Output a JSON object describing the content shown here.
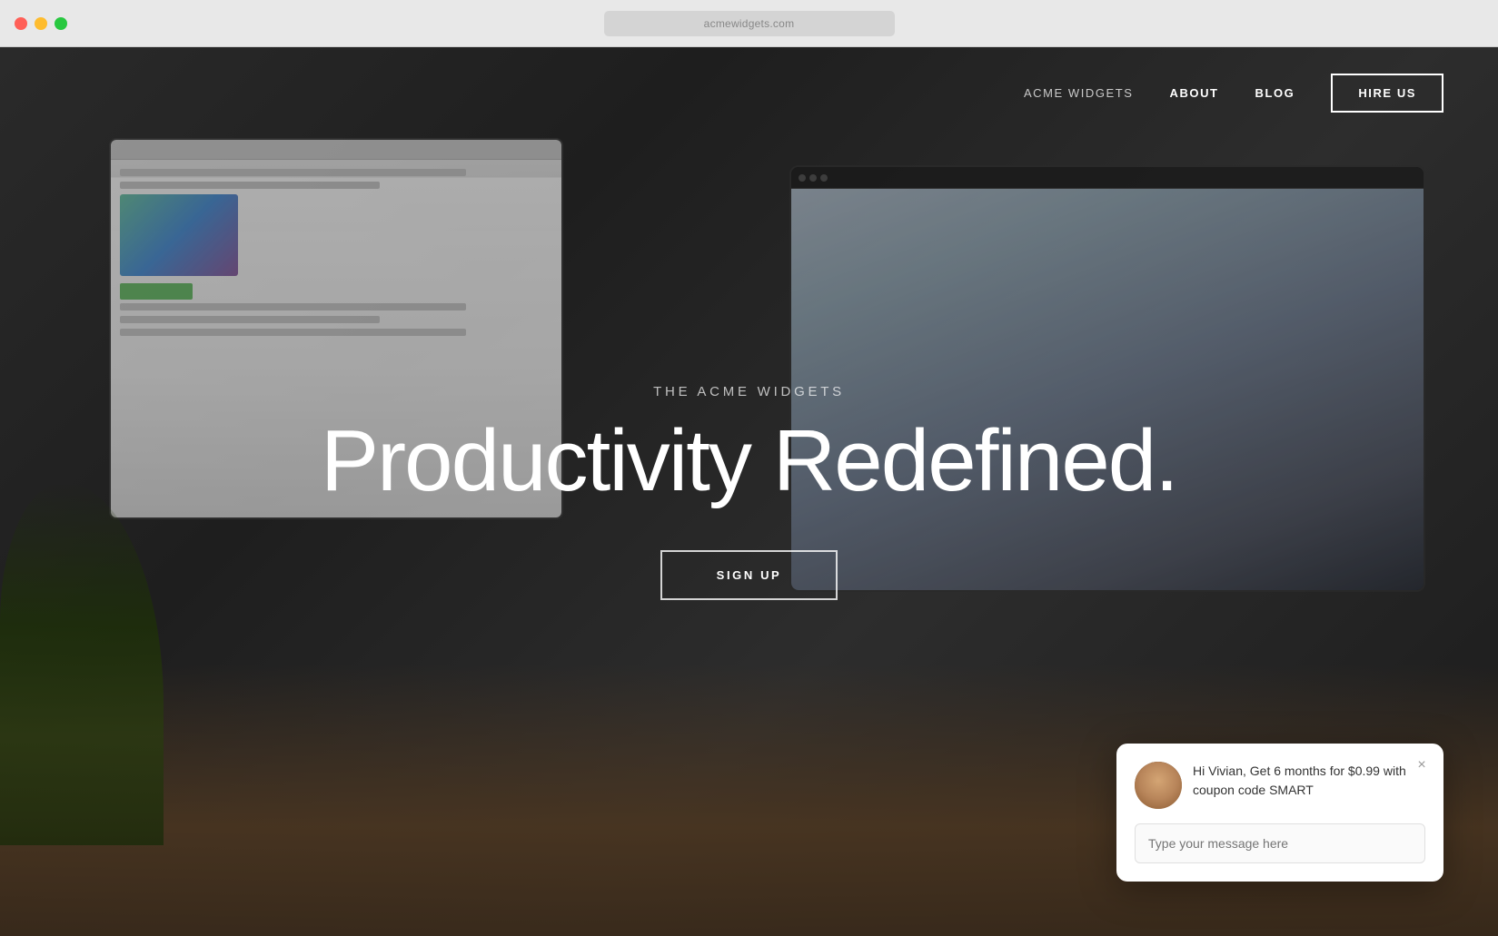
{
  "window": {
    "title": "The Acme Widgets",
    "address_bar_text": "acmewidgets.com"
  },
  "nav": {
    "acme_widgets_label": "ACME WIDGETS",
    "about_label": "ABOUT",
    "blog_label": "BLOG",
    "hire_us_label": "HIRE US"
  },
  "hero": {
    "subtitle": "THE ACME WIDGETS",
    "title": "Productivity Redefined.",
    "cta_label": "SIGN UP"
  },
  "chat": {
    "message": "Hi Vivian, Get 6 months for $0.99 with coupon code SMART",
    "input_placeholder": "Type your message here",
    "close_label": "×"
  }
}
